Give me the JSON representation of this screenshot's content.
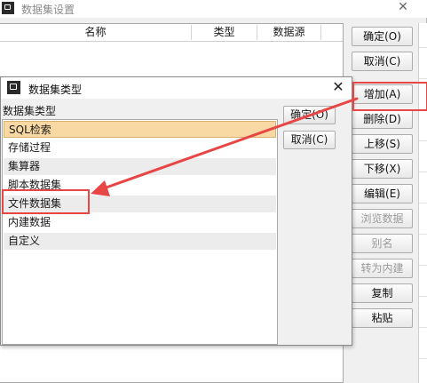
{
  "main_window": {
    "title": "数据集设置",
    "columns": [
      "名称",
      "类型",
      "数据源"
    ],
    "buttons": [
      {
        "label": "确定(O)",
        "enabled": true
      },
      {
        "label": "取消(C)",
        "enabled": true
      },
      {
        "label": "增加(A)",
        "enabled": true
      },
      {
        "label": "删除(D)",
        "enabled": true
      },
      {
        "label": "上移(S)",
        "enabled": true
      },
      {
        "label": "下移(X)",
        "enabled": true
      },
      {
        "label": "编辑(E)",
        "enabled": true
      },
      {
        "label": "浏览数据",
        "enabled": false
      },
      {
        "label": "别名",
        "enabled": false
      },
      {
        "label": "转为内建",
        "enabled": false
      },
      {
        "label": "复制",
        "enabled": true
      },
      {
        "label": "粘贴",
        "enabled": true
      }
    ]
  },
  "dialog": {
    "title": "数据集类型",
    "list_label": "数据集类型",
    "items": [
      "SQL检索",
      "存储过程",
      "集算器",
      "脚本数据集",
      "文件数据集",
      "内建数据",
      "自定义"
    ],
    "selected_index": 0,
    "ok_label": "确定(O)",
    "cancel_label": "取消(C)"
  },
  "annotation": {
    "color": "#e84545",
    "highlighted_button": "增加(A)",
    "highlighted_item": "文件数据集"
  }
}
